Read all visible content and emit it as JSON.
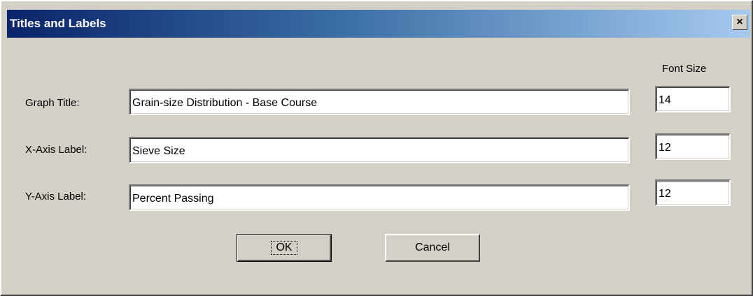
{
  "window": {
    "title": "Titles and Labels",
    "close_glyph": "×"
  },
  "form": {
    "font_size_header": "Font Size",
    "graph_title": {
      "label": "Graph Title:",
      "value": "Grain-size Distribution - Base Course",
      "font_size": "14"
    },
    "x_axis": {
      "label": "X-Axis Label:",
      "value": "Sieve Size",
      "font_size": "12"
    },
    "y_axis": {
      "label": "Y-Axis Label:",
      "value": "Percent Passing",
      "font_size": "12"
    }
  },
  "buttons": {
    "ok_label": "OK",
    "cancel_label": "Cancel"
  }
}
